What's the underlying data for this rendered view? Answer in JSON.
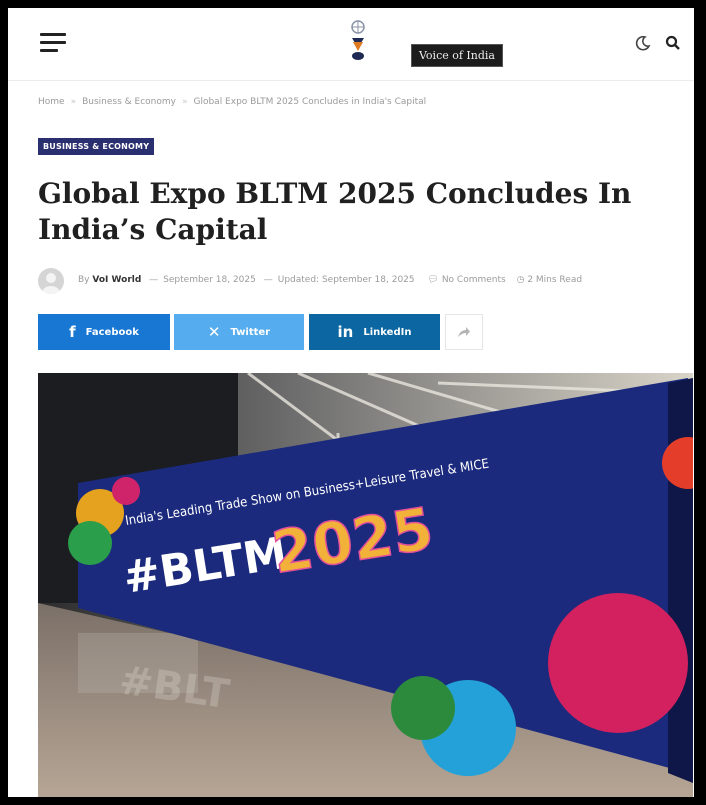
{
  "header": {
    "tooltip": "Voice of India",
    "menu_icon": "hamburger-menu-icon",
    "dark_mode_icon": "moon-icon",
    "search_icon": "search-icon"
  },
  "breadcrumb": {
    "items": [
      "Home",
      "Business & Economy",
      "Global Expo BLTM 2025 Concludes in India's Capital"
    ]
  },
  "article": {
    "category": "BUSINESS & ECONOMY",
    "title": "Global Expo BLTM 2025 Concludes In India’s Capital",
    "meta": {
      "by": "By",
      "author": "VoI World",
      "published": "September 18, 2025",
      "updated_label": "Updated:",
      "updated": "September 18, 2025",
      "comments": "No Comments",
      "read_time": "2 Mins Read"
    }
  },
  "share": {
    "facebook": "Facebook",
    "twitter": "Twitter",
    "linkedin": "LinkedIn"
  },
  "photo": {
    "banner_tagline": "India's Leading Trade Show on Business+Leisure Travel & MICE",
    "banner_hashtag": "#BLTM",
    "banner_year": "2025"
  },
  "colors": {
    "category_bg": "#2a2f6f",
    "facebook": "#1877d3",
    "twitter": "#55acee",
    "linkedin": "#0b66a2"
  }
}
